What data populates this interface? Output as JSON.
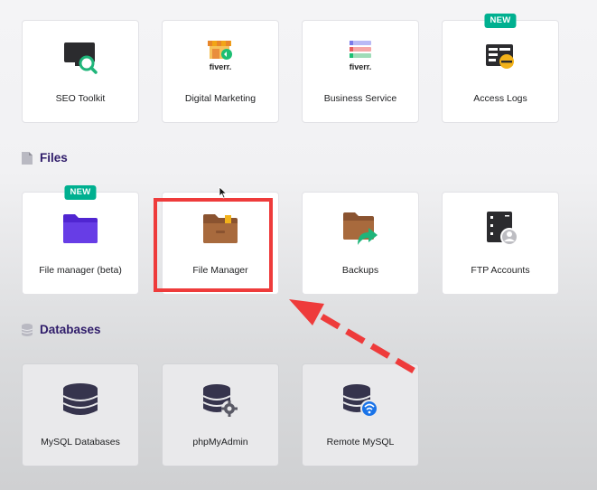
{
  "top_row": [
    {
      "label": "SEO Toolkit",
      "icon": "seo-toolkit-icon",
      "badge": ""
    },
    {
      "label": "Digital Marketing",
      "icon": "fiverr-marketing-icon",
      "badge": "",
      "logo_text": "fiverr."
    },
    {
      "label": "Business Service",
      "icon": "fiverr-business-icon",
      "badge": "",
      "logo_text": "fiverr."
    },
    {
      "label": "Access Logs",
      "icon": "access-logs-icon",
      "badge": "NEW"
    }
  ],
  "files_section": {
    "title": "Files",
    "items": [
      {
        "label": "File manager (beta)",
        "icon": "purple-folder-icon",
        "badge": "NEW"
      },
      {
        "label": "File Manager",
        "icon": "brown-folder-icon",
        "badge": ""
      },
      {
        "label": "Backups",
        "icon": "backup-folder-icon",
        "badge": ""
      },
      {
        "label": "FTP Accounts",
        "icon": "ftp-server-icon",
        "badge": ""
      }
    ]
  },
  "databases_section": {
    "title": "Databases",
    "items": [
      {
        "label": "MySQL Databases",
        "icon": "database-icon"
      },
      {
        "label": "phpMyAdmin",
        "icon": "database-gear-icon"
      },
      {
        "label": "Remote MySQL",
        "icon": "database-wifi-icon"
      }
    ]
  },
  "colors": {
    "badge": "#00b090",
    "highlight": "#ee3b3b",
    "section_title": "#2f1c6a"
  }
}
